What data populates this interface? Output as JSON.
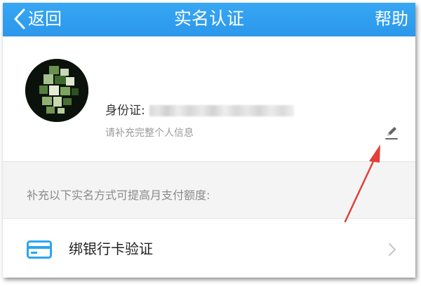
{
  "navbar": {
    "back_label": "返回",
    "title": "实名认证",
    "help_label": "帮助",
    "background_color": "#2b97eb"
  },
  "profile": {
    "id_label": "身份证:",
    "hint": "请补充完整个人信息",
    "edit_icon": "pencil-icon"
  },
  "notice": {
    "text": "补充以下实名方式可提高月支付额度:"
  },
  "verification_methods": [
    {
      "label": "绑银行卡验证",
      "icon": "bank-card-icon",
      "accent_color": "#2ba6ee"
    }
  ],
  "annotation": {
    "arrow_color": "#e0413a"
  }
}
